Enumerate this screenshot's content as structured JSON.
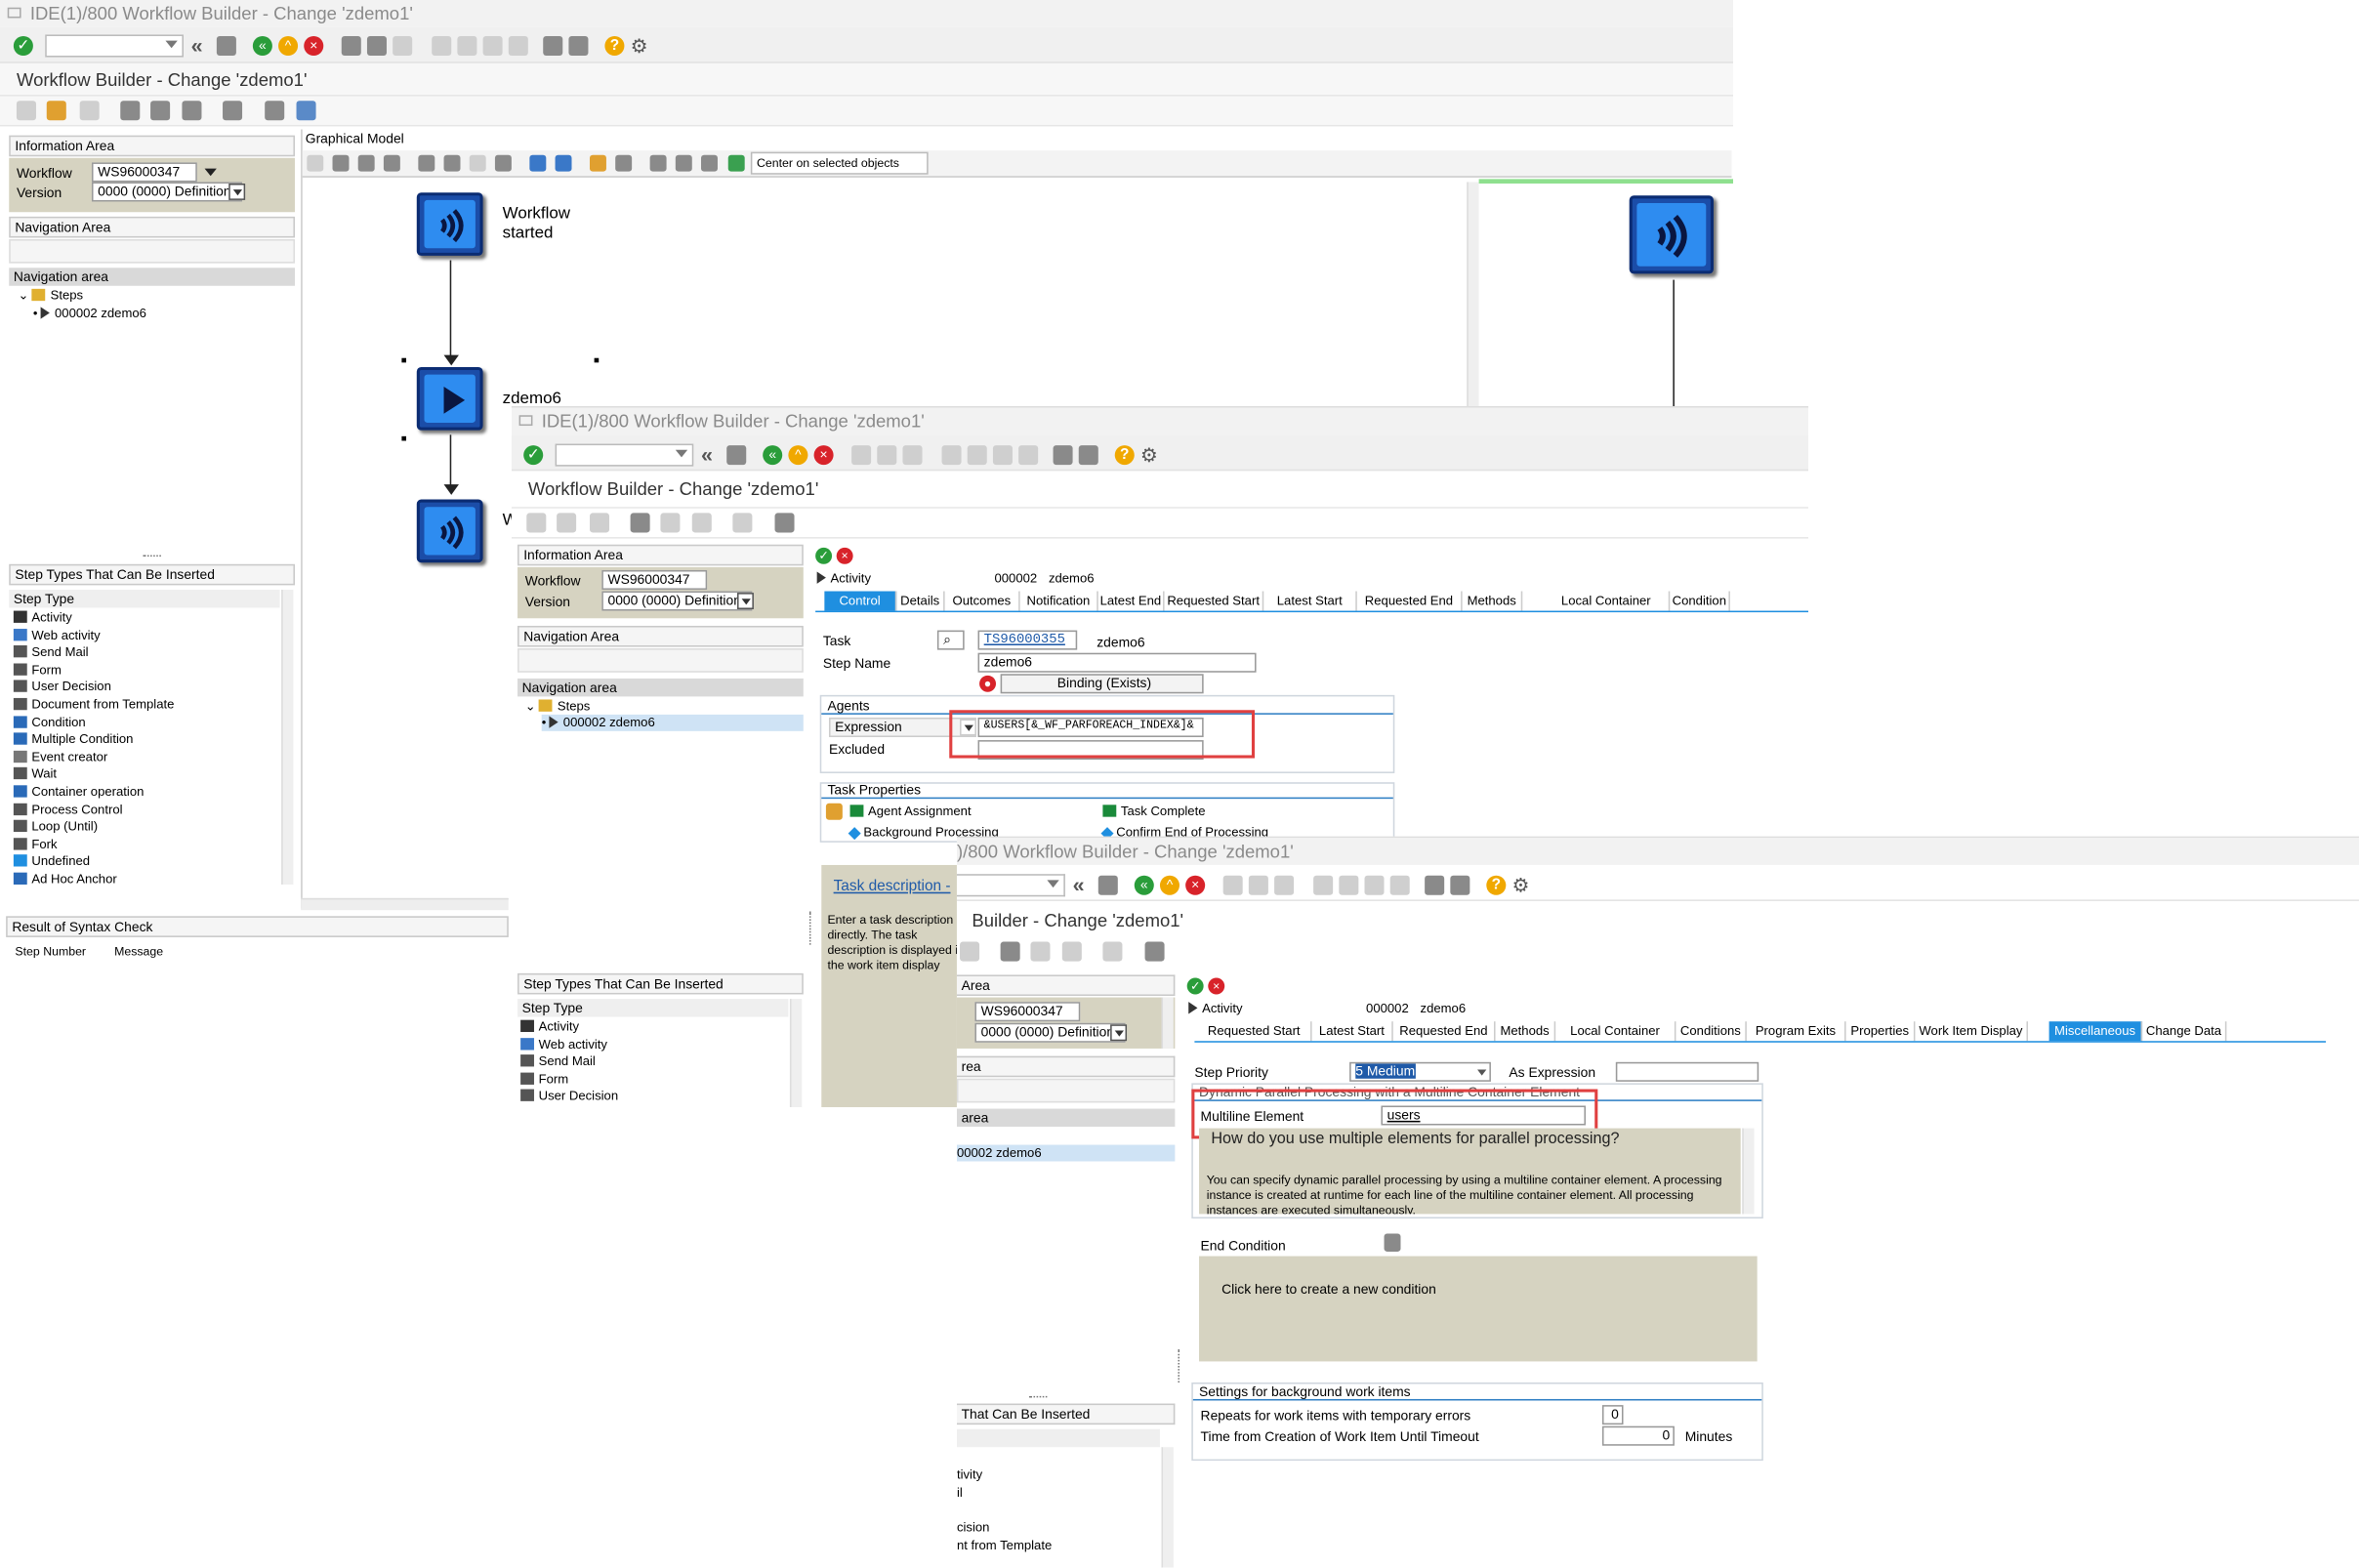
{
  "window1": {
    "title": "IDE(1)/800 Workflow Builder - Change 'zdemo1'",
    "app_title": "Workflow Builder - Change 'zdemo1'",
    "info_area": {
      "header": "Information Area",
      "workflow_label": "Workflow",
      "workflow_value": "WS96000347",
      "version_label": "Version",
      "version_value": "0000 (0000) Definition"
    },
    "nav_header": "Navigation Area",
    "nav_area_label": "Navigation area",
    "tree": {
      "root": "Steps",
      "child": "000002 zdemo6"
    },
    "step_types_header": "Step Types That Can Be Inserted",
    "step_type_col": "Step Type",
    "step_types": [
      "Activity",
      "Web activity",
      "Send Mail",
      "Form",
      "User Decision",
      "Document from Template",
      "Condition",
      "Multiple Condition",
      "Event creator",
      "Wait",
      "Container operation",
      "Process Control",
      "Loop (Until)",
      "Fork",
      "Undefined",
      "Ad Hoc Anchor"
    ],
    "syntax_header": "Result of Syntax Check",
    "syntax_cols": [
      "Step Number",
      "Message"
    ],
    "graph_header": "Graphical Model",
    "center_btn": "Center on selected objects",
    "node_start_label": "Workflow started",
    "node_step_label": "zdemo6",
    "node_w_label": "W"
  },
  "window2": {
    "title": "IDE(1)/800 Workflow Builder - Change 'zdemo1'",
    "app_title": "Workflow Builder - Change 'zdemo1'",
    "info_header": "Information Area",
    "workflow_label": "Workflow",
    "workflow_value": "WS96000347",
    "version_label": "Version",
    "version_value": "0000 (0000) Definition",
    "nav_header": "Navigation Area",
    "nav_area_label": "Navigation area",
    "tree": {
      "root": "Steps",
      "child": "000002 zdemo6"
    },
    "step_types_header": "Step Types That Can Be Inserted",
    "step_type_col": "Step Type",
    "step_types": [
      "Activity",
      "Web activity",
      "Send Mail",
      "Form",
      "User Decision"
    ],
    "activity_label": "Activity",
    "activity_num": "000002",
    "activity_name": "zdemo6",
    "tabs": [
      "Control",
      "Details",
      "Outcomes",
      "Notification",
      "Latest End",
      "Requested Start",
      "Latest Start",
      "Requested End",
      "Methods",
      "Local Container",
      "Condition"
    ],
    "task_label": "Task",
    "task_value": "TS96000355",
    "task_desc": "zdemo6",
    "step_name_label": "Step Name",
    "step_name_value": "zdemo6",
    "binding_btn": "Binding (Exists)",
    "agents_header": "Agents",
    "expression_label": "Expression",
    "expression_value": "&USERS[&_WF_PARFOREACH_INDEX&]&",
    "excluded_label": "Excluded",
    "task_props_header": "Task Properties",
    "props": [
      "Agent Assignment",
      "Task Complete",
      "Background Processing",
      "Confirm End of Processing"
    ],
    "task_desc_link": "Task description -",
    "task_desc_text": "Enter a task description directly. The task description is displayed in the work item display"
  },
  "window3": {
    "title": ")/800 Workflow Builder - Change 'zdemo1'",
    "app_title": "Builder - Change 'zdemo1'",
    "area_label": "Area",
    "workflow_value": "WS96000347",
    "version_value": "0000 (0000) Definition",
    "area2_label": "rea",
    "area3_label": "area",
    "tree_child": "00002 zdemo6",
    "step_types_header": "That Can Be Inserted",
    "partial_types": [
      "tivity",
      "il",
      "cision",
      "nt from Template"
    ],
    "activity_label": "Activity",
    "activity_num": "000002",
    "activity_name": "zdemo6",
    "tabs": [
      "Requested Start",
      "Latest Start",
      "Requested End",
      "Methods",
      "Local Container",
      "Conditions",
      "Program Exits",
      "Properties",
      "Work Item Display",
      "Miscellaneous",
      "Change Data"
    ],
    "step_priority_label": "Step Priority",
    "step_priority_value": "5 Medium",
    "as_expression_label": "As Expression",
    "dyn_header": "Dynamic Parallel Processing with a Multiline Container Element",
    "multiline_label": "Multiline Element",
    "multiline_value": "users",
    "help_title": "How do you use multiple elements for parallel processing?",
    "help_text": "You can specify dynamic parallel processing by using a multiline container element. A processing instance is created at runtime for each line of the multiline container element. All processing instances are executed simultaneously.",
    "end_condition_label": "End Condition",
    "create_condition": "Click here to create a new condition",
    "bg_header": "Settings for background work items",
    "repeats_label": "Repeats for work items with temporary errors",
    "repeats_value": "0",
    "time_label": "Time from Creation of Work Item Until Timeout",
    "time_value": "0",
    "minutes_label": "Minutes"
  },
  "colors": {
    "accent": "#1f8fe0",
    "highlight": "#e04040",
    "node_blue": "#2e8cf0",
    "khaki": "#d6d3c1"
  }
}
